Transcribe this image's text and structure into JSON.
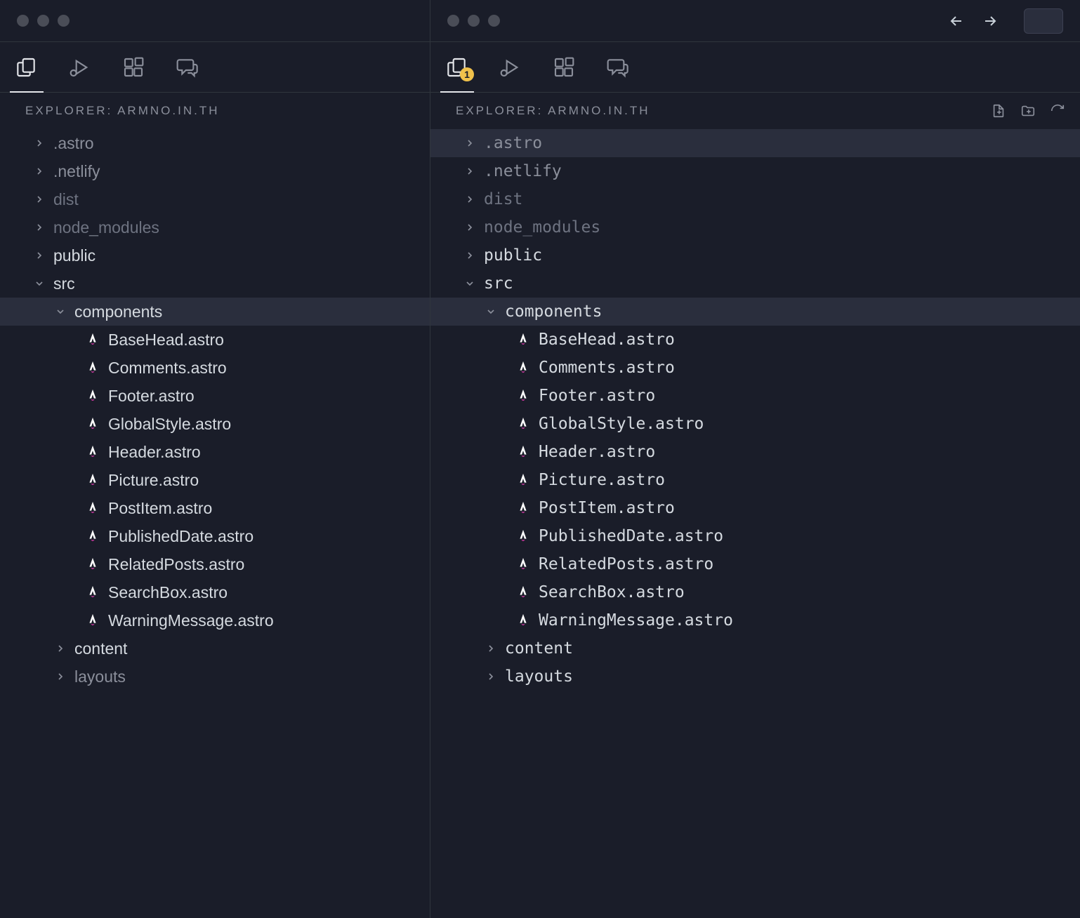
{
  "left": {
    "explorer_label": "EXPLORER: ARMNO.IN.TH",
    "badge": null,
    "mono": false,
    "tree": [
      {
        "type": "folder",
        "name": ".astro",
        "depth": 0,
        "expanded": false,
        "shade": "muted"
      },
      {
        "type": "folder",
        "name": ".netlify",
        "depth": 0,
        "expanded": false,
        "shade": "muted"
      },
      {
        "type": "folder",
        "name": "dist",
        "depth": 0,
        "expanded": false,
        "shade": "dimmed"
      },
      {
        "type": "folder",
        "name": "node_modules",
        "depth": 0,
        "expanded": false,
        "shade": "dimmed"
      },
      {
        "type": "folder",
        "name": "public",
        "depth": 0,
        "expanded": false,
        "shade": "normal"
      },
      {
        "type": "folder",
        "name": "src",
        "depth": 0,
        "expanded": true,
        "shade": "normal"
      },
      {
        "type": "folder",
        "name": "components",
        "depth": 1,
        "expanded": true,
        "shade": "normal",
        "selected": true
      },
      {
        "type": "file",
        "name": "BaseHead.astro",
        "depth": 2,
        "shade": "normal"
      },
      {
        "type": "file",
        "name": "Comments.astro",
        "depth": 2,
        "shade": "normal"
      },
      {
        "type": "file",
        "name": "Footer.astro",
        "depth": 2,
        "shade": "normal"
      },
      {
        "type": "file",
        "name": "GlobalStyle.astro",
        "depth": 2,
        "shade": "normal"
      },
      {
        "type": "file",
        "name": "Header.astro",
        "depth": 2,
        "shade": "normal"
      },
      {
        "type": "file",
        "name": "Picture.astro",
        "depth": 2,
        "shade": "normal"
      },
      {
        "type": "file",
        "name": "PostItem.astro",
        "depth": 2,
        "shade": "normal"
      },
      {
        "type": "file",
        "name": "PublishedDate.astro",
        "depth": 2,
        "shade": "normal"
      },
      {
        "type": "file",
        "name": "RelatedPosts.astro",
        "depth": 2,
        "shade": "normal"
      },
      {
        "type": "file",
        "name": "SearchBox.astro",
        "depth": 2,
        "shade": "normal"
      },
      {
        "type": "file",
        "name": "WarningMessage.astro",
        "depth": 2,
        "shade": "normal"
      },
      {
        "type": "folder",
        "name": "content",
        "depth": 1,
        "expanded": false,
        "shade": "normal"
      },
      {
        "type": "folder",
        "name": "layouts",
        "depth": 1,
        "expanded": false,
        "shade": "muted"
      }
    ]
  },
  "right": {
    "explorer_label": "EXPLORER: ARMNO.IN.TH",
    "badge": "1",
    "mono": true,
    "tree": [
      {
        "type": "folder",
        "name": ".astro",
        "depth": 0,
        "expanded": false,
        "shade": "muted",
        "selected": true
      },
      {
        "type": "folder",
        "name": ".netlify",
        "depth": 0,
        "expanded": false,
        "shade": "muted"
      },
      {
        "type": "folder",
        "name": "dist",
        "depth": 0,
        "expanded": false,
        "shade": "dimmed"
      },
      {
        "type": "folder",
        "name": "node_modules",
        "depth": 0,
        "expanded": false,
        "shade": "dimmed"
      },
      {
        "type": "folder",
        "name": "public",
        "depth": 0,
        "expanded": false,
        "shade": "normal"
      },
      {
        "type": "folder",
        "name": "src",
        "depth": 0,
        "expanded": true,
        "shade": "normal"
      },
      {
        "type": "folder",
        "name": "components",
        "depth": 1,
        "expanded": true,
        "shade": "normal",
        "selected": true
      },
      {
        "type": "file",
        "name": "BaseHead.astro",
        "depth": 2,
        "shade": "normal"
      },
      {
        "type": "file",
        "name": "Comments.astro",
        "depth": 2,
        "shade": "normal"
      },
      {
        "type": "file",
        "name": "Footer.astro",
        "depth": 2,
        "shade": "normal"
      },
      {
        "type": "file",
        "name": "GlobalStyle.astro",
        "depth": 2,
        "shade": "normal"
      },
      {
        "type": "file",
        "name": "Header.astro",
        "depth": 2,
        "shade": "normal"
      },
      {
        "type": "file",
        "name": "Picture.astro",
        "depth": 2,
        "shade": "normal"
      },
      {
        "type": "file",
        "name": "PostItem.astro",
        "depth": 2,
        "shade": "normal"
      },
      {
        "type": "file",
        "name": "PublishedDate.astro",
        "depth": 2,
        "shade": "normal"
      },
      {
        "type": "file",
        "name": "RelatedPosts.astro",
        "depth": 2,
        "shade": "normal"
      },
      {
        "type": "file",
        "name": "SearchBox.astro",
        "depth": 2,
        "shade": "normal"
      },
      {
        "type": "file",
        "name": "WarningMessage.astro",
        "depth": 2,
        "shade": "normal"
      },
      {
        "type": "folder",
        "name": "content",
        "depth": 1,
        "expanded": false,
        "shade": "normal"
      },
      {
        "type": "folder",
        "name": "layouts",
        "depth": 1,
        "expanded": false,
        "shade": "normal"
      }
    ]
  }
}
